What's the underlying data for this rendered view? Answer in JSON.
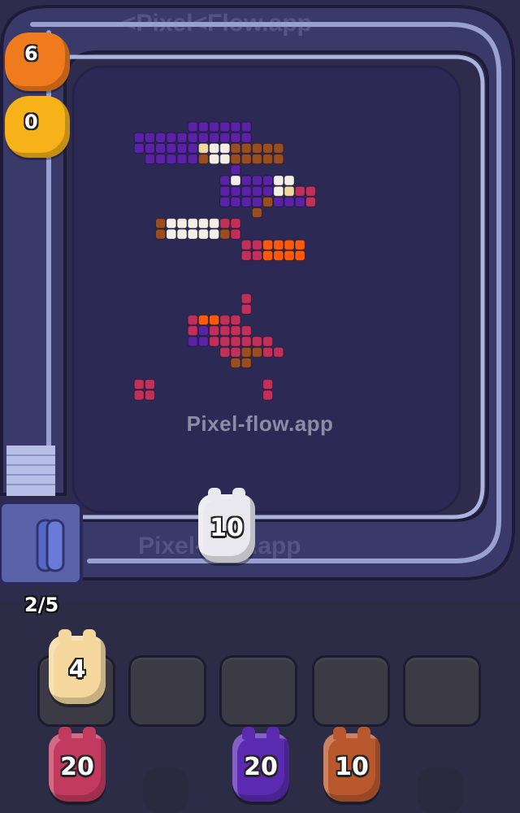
{
  "watermark": {
    "center": "Pixel-flow.app",
    "rail_top": "<Pixel<Flow.app",
    "rail_bottom": "Pixel-flow.app",
    "slots_overlay": "Pixel-Flow.app"
  },
  "conveyor": {
    "capacity_label": "2/5",
    "belt_color": "#9aa6d8",
    "track_color": "#3d3d6e"
  },
  "hands": [
    {
      "name": "orange-hand",
      "value": "6",
      "color": "#f07a1e"
    },
    {
      "name": "yellow-hand",
      "value": "0",
      "color": "#f7b21a"
    }
  ],
  "belt_pig": {
    "value": "10",
    "color": "#e8e8ee"
  },
  "slots": [
    {
      "index": 1,
      "pig": {
        "value": "4",
        "color": "#f3d79c"
      }
    },
    {
      "index": 2,
      "pig": null
    },
    {
      "index": 3,
      "pig": null
    },
    {
      "index": 4,
      "pig": null
    },
    {
      "index": 5,
      "pig": null
    }
  ],
  "queue": [
    {
      "column": 1,
      "value": "20",
      "color": "#c23a5e"
    },
    {
      "column": 2,
      "value": "",
      "color": "#2a2a3e"
    },
    {
      "column": 3,
      "value": "20",
      "color": "#5a2bb0"
    },
    {
      "column": 4,
      "value": "10",
      "color": "#b9582c"
    },
    {
      "column": 5,
      "value": "",
      "color": "#2a2a3e"
    }
  ],
  "pixel_art": {
    "colors": {
      "P": "#5a23a6",
      "W": "#f4efe6",
      "Y": "#efd9a0",
      "B": "#9a4d1e",
      "R": "#c0305a",
      "O": "#ff5a0c",
      "K": "#2a2250"
    },
    "rows": [
      {
        "row": 0,
        "cells": "......PPPPPP"
      },
      {
        "row": 1,
        "cells": ".PPPPPPPPPPP"
      },
      {
        "row": 2,
        "cells": ".PPPPPPYWWBBBBB"
      },
      {
        "row": 3,
        "cells": "..PPPPPBWWBBBBB"
      },
      {
        "row": 4,
        "cells": "..........P"
      },
      {
        "row": 5,
        "cells": ".........PWPPPWW"
      },
      {
        "row": 6,
        "cells": ".........PPPPPWYRR"
      },
      {
        "row": 7,
        "cells": ".........PPPPBPPPR"
      },
      {
        "row": 8,
        "cells": "............B"
      },
      {
        "row": 9,
        "cells": "...BWWWWWRR"
      },
      {
        "row": 10,
        "cells": "...BWWWWWBR"
      },
      {
        "row": 11,
        "cells": "...........RROOOO"
      },
      {
        "row": 12,
        "cells": "...........RROOOO"
      },
      {
        "row": 16,
        "cells": "...........R"
      },
      {
        "row": 17,
        "cells": "...........R"
      },
      {
        "row": 18,
        "cells": "......ROORR"
      },
      {
        "row": 19,
        "cells": "......RPRRRR"
      },
      {
        "row": 20,
        "cells": "......PPRRRRRR"
      },
      {
        "row": 21,
        "cells": ".........RRBBRR"
      },
      {
        "row": 22,
        "cells": "..........BB"
      },
      {
        "row": 24,
        "cells": ".RR..........R"
      },
      {
        "row": 25,
        "cells": ".RR..........R"
      }
    ]
  }
}
